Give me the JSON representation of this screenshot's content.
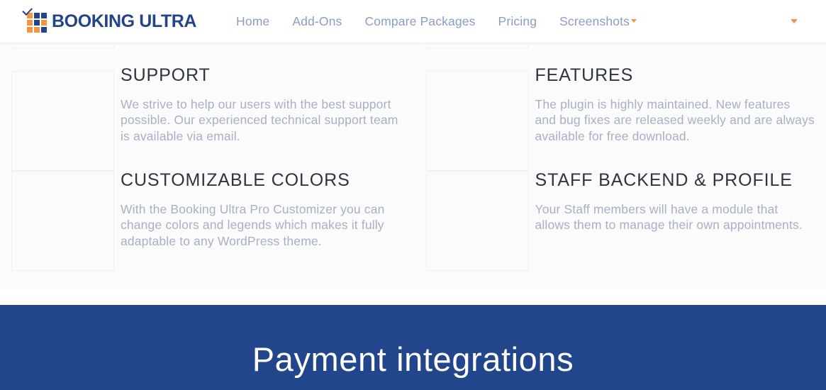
{
  "header": {
    "brand": {
      "name": "BOOKING ULTRA",
      "mark_icon": "grid-check-icon",
      "colors": {
        "orange": "#F3943F",
        "blue": "#22458A"
      }
    },
    "nav": [
      {
        "label": "Home",
        "has_caret": false
      },
      {
        "label": "Add-Ons",
        "has_caret": false
      },
      {
        "label": "Compare Packages",
        "has_caret": false
      },
      {
        "label": "Pricing",
        "has_caret": false
      },
      {
        "label": "Screenshots",
        "has_caret": true
      }
    ],
    "right_toggle_icon": "caret-down-icon"
  },
  "features": {
    "background": "#fbfbfc",
    "items": [
      {
        "title": "SUPPORT",
        "desc": "We strive to help our users with the best support possible. Our experienced technical support team is available via email.",
        "icon": "support-image-placeholder"
      },
      {
        "title": "FEATURES",
        "desc": "The plugin is highly maintained. New features and bug fixes are released weekly and are always available for free download.",
        "icon": "features-image-placeholder"
      },
      {
        "title": "CUSTOMIZABLE COLORS",
        "desc": "With the Booking Ultra Pro Customizer you can change colors and legends which makes it fully adaptable to any WordPress theme.",
        "icon": "colors-image-placeholder"
      },
      {
        "title": "STAFF BACKEND & PROFILE",
        "desc": "Your Staff members will have a module that allows them to manage their own appointments.",
        "icon": "staff-image-placeholder"
      }
    ]
  },
  "payments": {
    "title": "Payment integrations",
    "background": "#21468B",
    "text_color": "#ffffff"
  }
}
